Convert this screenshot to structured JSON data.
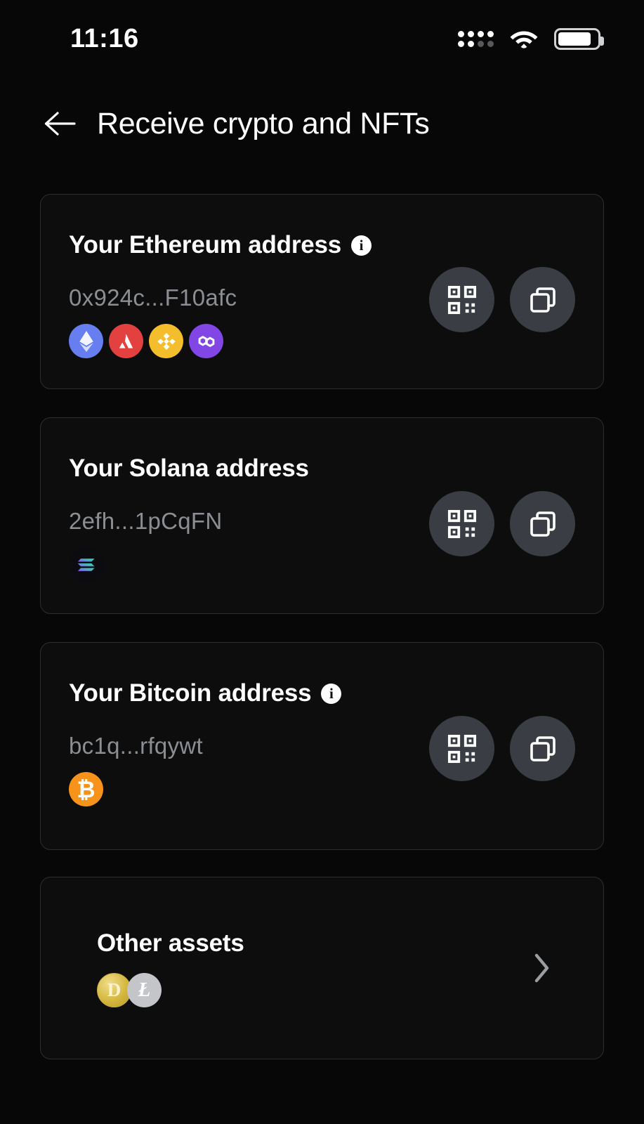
{
  "status_bar": {
    "time": "11:16",
    "signal_icon": "signal-dots-icon",
    "wifi_icon": "wifi-icon",
    "battery_icon": "battery-icon",
    "battery_level_pct": 86
  },
  "header": {
    "back_icon": "back-arrow-icon",
    "title": "Receive crypto and NFTs"
  },
  "cards": [
    {
      "id": "ethereum",
      "title": "Your Ethereum address",
      "has_info_icon": true,
      "info_icon": "info-icon",
      "address": "0x924c...F10afc",
      "chains": [
        {
          "name": "ethereum",
          "symbol": "Ξ",
          "color": "#667ef0"
        },
        {
          "name": "avalanche",
          "symbol": "A",
          "color": "#e2413f"
        },
        {
          "name": "bnb",
          "symbol": "◆",
          "color": "#f4bd2c"
        },
        {
          "name": "polygon",
          "symbol": "∞",
          "color": "#8146e4"
        }
      ],
      "qr_button_label": "qr-code-icon",
      "copy_button_label": "copy-icon"
    },
    {
      "id": "solana",
      "title": "Your Solana address",
      "has_info_icon": false,
      "address": "2efh...1pCqFN",
      "chains": [
        {
          "name": "solana",
          "symbol": "",
          "color": "#0b0b10"
        }
      ],
      "qr_button_label": "qr-code-icon",
      "copy_button_label": "copy-icon"
    },
    {
      "id": "bitcoin",
      "title": "Your Bitcoin address",
      "has_info_icon": true,
      "info_icon": "info-icon",
      "address": "bc1q...rfqywt",
      "chains": [
        {
          "name": "bitcoin",
          "symbol": "₿",
          "color": "#f7931a"
        }
      ],
      "qr_button_label": "qr-code-icon",
      "copy_button_label": "copy-icon"
    }
  ],
  "other_assets": {
    "title": "Other assets",
    "chevron_icon": "chevron-right-icon",
    "chains": [
      {
        "name": "dogecoin",
        "symbol": "D",
        "color": "#d4b73f"
      },
      {
        "name": "litecoin",
        "symbol": "Ł",
        "color": "#c3c5c8"
      }
    ]
  },
  "theme": {
    "background": "#070707",
    "card_background": "#0d0d0e",
    "card_border": "#2b2e33",
    "text_primary": "#ffffff",
    "text_muted": "#8b8e92",
    "action_button_bg": "#3a3d44"
  }
}
